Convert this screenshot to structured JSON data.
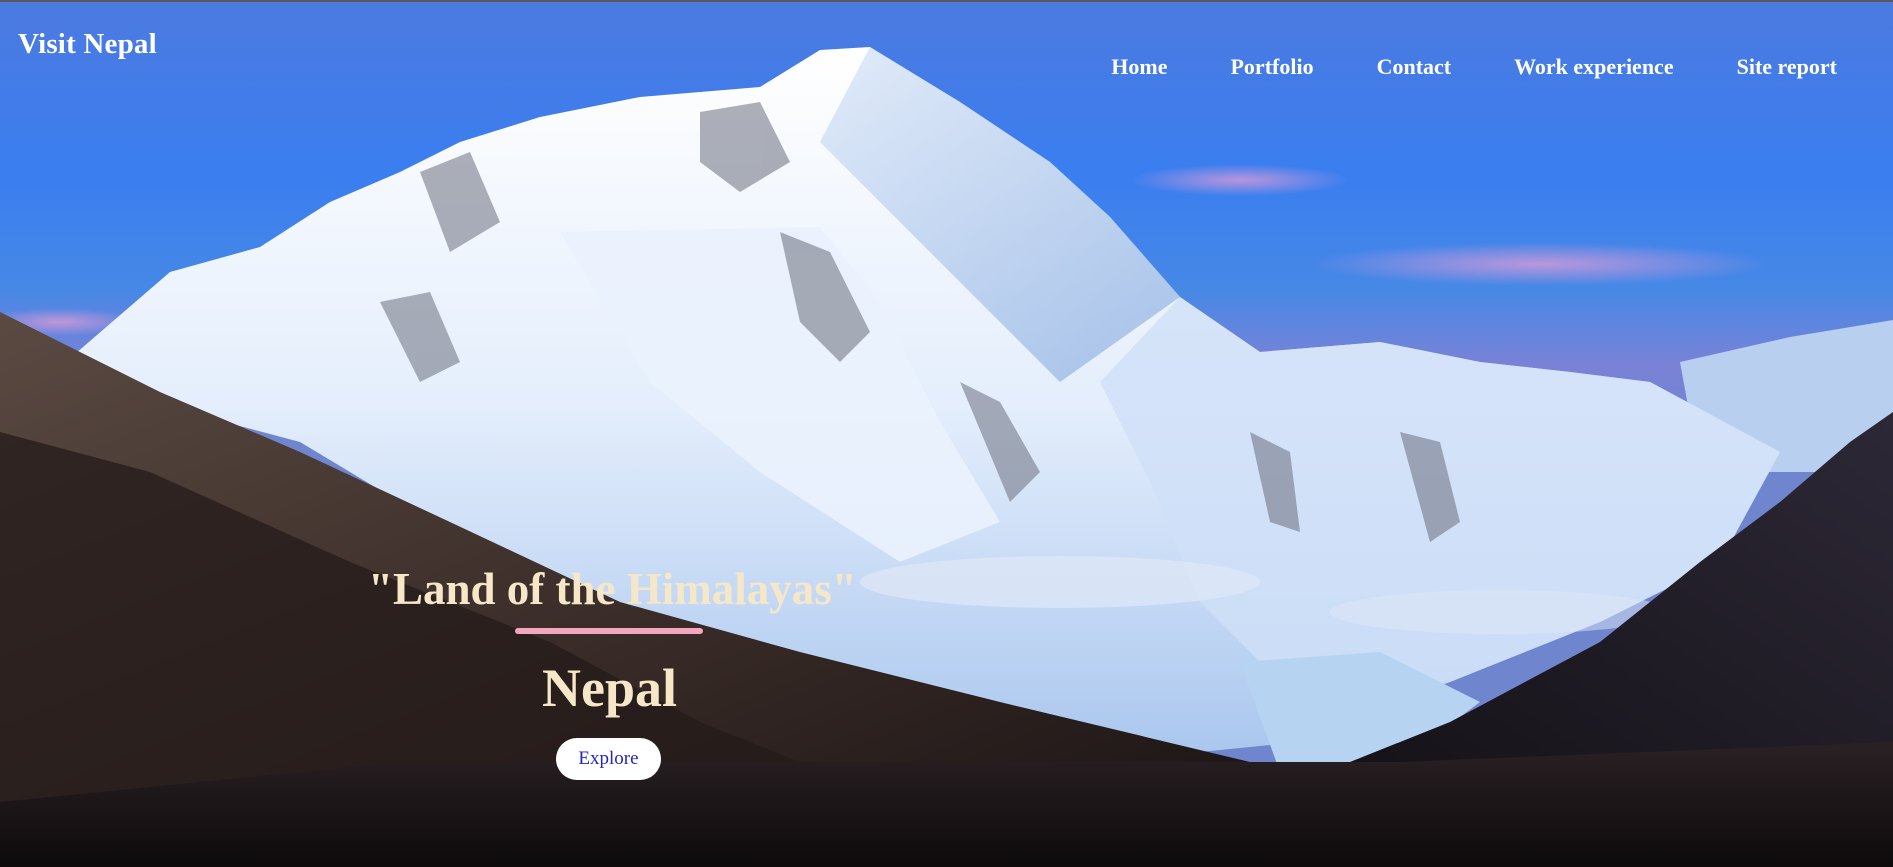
{
  "header": {
    "brand": "Visit Nepal"
  },
  "nav": {
    "items": [
      "Home",
      "Portfolio",
      "Contact",
      "Work experience",
      "Site report"
    ]
  },
  "hero": {
    "tagline": "\"Land of the Himalayas\"",
    "title": "Nepal",
    "cta_label": "Explore",
    "background_image": "mountain-landscape"
  },
  "colors": {
    "sky": "#3f7be8",
    "accent_underline": "#f5a6bf",
    "heading_text": "#f6e7c8",
    "button_text": "#2424c8"
  }
}
